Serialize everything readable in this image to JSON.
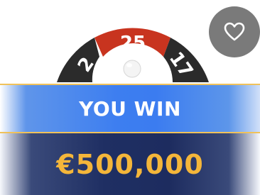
{
  "wheel": {
    "segments": [
      {
        "number": "2",
        "color": "#2b2b2b"
      },
      {
        "number": "25",
        "color": "#c8341f"
      },
      {
        "number": "17",
        "color": "#2b2b2b"
      }
    ],
    "winning_number": "25"
  },
  "favorite": {
    "icon": "heart-outline-icon"
  },
  "result": {
    "title": "YOU WIN",
    "prize": "€500,000"
  },
  "colors": {
    "banner_blue": "#3d7ef0",
    "gold": "#f4b63a",
    "prize_panel": "#1f2f63",
    "red_segment": "#c8341f",
    "black_segment": "#2b2b2b"
  }
}
